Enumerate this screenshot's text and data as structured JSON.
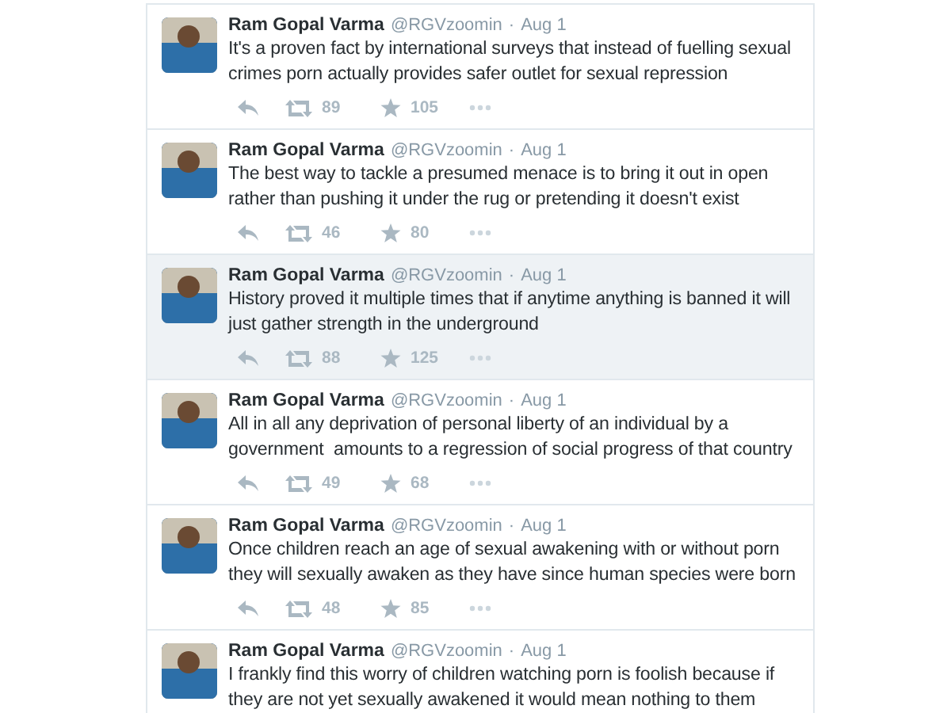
{
  "tweets": [
    {
      "name": "Ram Gopal Varma",
      "handle": "@RGVzoomin",
      "separator": "·",
      "date": "Aug 1",
      "text": "It's a proven fact by international surveys that instead of fuelling sexual crimes porn actually provides safer outlet for sexual repression",
      "retweets": "89",
      "favorites": "105",
      "highlighted": false
    },
    {
      "name": "Ram Gopal Varma",
      "handle": "@RGVzoomin",
      "separator": "·",
      "date": "Aug 1",
      "text": "The best way to tackle a presumed menace is to bring it out in open rather than pushing it under the rug or pretending it doesn't exist",
      "retweets": "46",
      "favorites": "80",
      "highlighted": false
    },
    {
      "name": "Ram Gopal Varma",
      "handle": "@RGVzoomin",
      "separator": "·",
      "date": "Aug 1",
      "text": "History proved it multiple times that if anytime anything is banned it will just gather strength in the underground",
      "retweets": "88",
      "favorites": "125",
      "highlighted": true
    },
    {
      "name": "Ram Gopal Varma",
      "handle": "@RGVzoomin",
      "separator": "·",
      "date": "Aug 1",
      "text": "All in all any deprivation of personal liberty of an individual by a government  amounts to a regression of social progress of that country",
      "retweets": "49",
      "favorites": "68",
      "highlighted": false
    },
    {
      "name": "Ram Gopal Varma",
      "handle": "@RGVzoomin",
      "separator": "·",
      "date": "Aug 1",
      "text": "Once children reach an age of sexual awakening with or without porn they will sexually awaken as they have since human species were born",
      "retweets": "48",
      "favorites": "85",
      "highlighted": false
    },
    {
      "name": "Ram Gopal Varma",
      "handle": "@RGVzoomin",
      "separator": "·",
      "date": "Aug 1",
      "text": "I frankly find this worry of children watching porn is foolish because if they are not yet sexually awakened it would mean nothing to them",
      "highlighted": false
    }
  ]
}
